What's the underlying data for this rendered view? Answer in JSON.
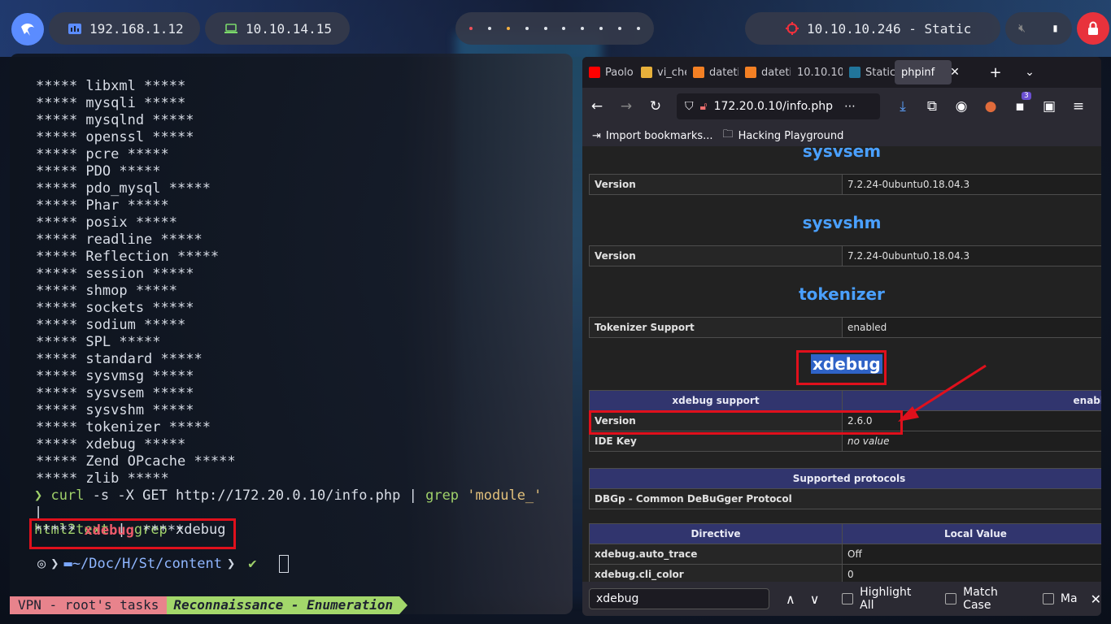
{
  "topbar": {
    "local_ip": "192.168.1.12",
    "vpn_ip": "10.10.14.15",
    "target": "10.10.10.246 - Static"
  },
  "terminal": {
    "module_lines": [
      "***** libxml *****",
      "***** mysqli *****",
      "***** mysqlnd *****",
      "***** openssl *****",
      "***** pcre *****",
      "***** PDO *****",
      "***** pdo_mysql *****",
      "***** Phar *****",
      "***** posix *****",
      "***** readline *****",
      "***** Reflection *****",
      "***** session *****",
      "***** shmop *****",
      "***** sockets *****",
      "***** sodium *****",
      "***** SPL *****",
      "***** standard *****",
      "***** sysvmsg *****",
      "***** sysvsem *****",
      "***** sysvshm *****",
      "***** tokenizer *****",
      "***** xdebug *****",
      "***** Zend OPcache *****",
      "***** zlib *****"
    ],
    "command": {
      "prompt": "❯",
      "curl": "curl",
      "args": " -s -X GET http://172.20.0.10/info.php | ",
      "grep1": "grep",
      "pattern": " 'module_'",
      "pipe": " |",
      "html2text": "html2text",
      "pipe2": " | ",
      "grep2": "grep",
      "arg2": " xdebug"
    },
    "result": {
      "stars_left": "***** ",
      "match": "xdebug",
      "stars_right": " *****"
    },
    "prompt": {
      "path": "~/Doc/H/St/content",
      "check": "✔"
    },
    "status": {
      "session": "VPN - root's tasks",
      "window": "Reconnaissance - Enumeration"
    }
  },
  "browser": {
    "tabs": [
      {
        "label": "Paolo",
        "icon": "youtube-icon",
        "color": "#ff0000"
      },
      {
        "label": "vi_che",
        "icon": "uas-icon",
        "color": "#e7b03b"
      },
      {
        "label": "dateti",
        "icon": "stackoverflow-icon",
        "color": "#f48024"
      },
      {
        "label": "dateti",
        "icon": "stackoverflow-icon",
        "color": "#f48024"
      },
      {
        "label": "10.10.10",
        "icon": "",
        "color": "#2b2a33"
      },
      {
        "label": "Static",
        "icon": "wordpress-icon",
        "color": "#21759b"
      },
      {
        "label": "phpinf",
        "icon": "",
        "color": "#42414d"
      }
    ],
    "url": "172.20.0.10/info.php",
    "badge": "3",
    "bookmarks": [
      "Import bookmarks...",
      "Hacking Playground"
    ],
    "sections": {
      "sysvsem": {
        "title": "sysvsem",
        "key": "Version",
        "value": "7.2.24-0ubuntu0.18.04.3"
      },
      "sysvshm": {
        "title": "sysvshm",
        "key": "Version",
        "value": "7.2.24-0ubuntu0.18.04.3"
      },
      "tokenizer": {
        "title": "tokenizer",
        "key": "Tokenizer Support",
        "value": "enabled"
      },
      "xdebug": {
        "title": "xdebug",
        "header_key": "xdebug support",
        "header_val": "enabl",
        "version_key": "Version",
        "version_val": "2.6.0",
        "ide_key": "IDE Key",
        "ide_val": "no value",
        "protocols_header": "Supported protocols",
        "protocol": "DBGp - Common DeBuGger Protocol",
        "directive_header": "Directive",
        "local_header": "Local Value",
        "d1_key": "xdebug.auto_trace",
        "d1_val": "Off",
        "d2_key": "xdebug.cli_color",
        "d2_val": "0"
      }
    },
    "findbar": {
      "query": "xdebug",
      "highlight_all": "Highlight All",
      "match_case": "Match Case",
      "third": "Ma"
    }
  }
}
